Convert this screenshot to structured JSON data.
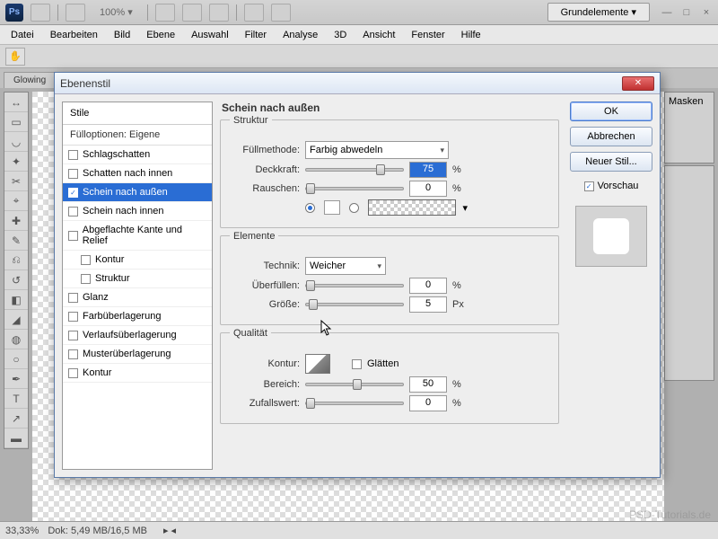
{
  "app": {
    "workspace": "Grundelemente ▾"
  },
  "menu": {
    "items": [
      "Datei",
      "Bearbeiten",
      "Bild",
      "Ebene",
      "Auswahl",
      "Filter",
      "Analyse",
      "3D",
      "Ansicht",
      "Fenster",
      "Hilfe"
    ]
  },
  "zoom_pct": "100% ▾",
  "doc_tab": "Glowing",
  "right_tab": "Masken",
  "status": {
    "zoom": "33,33%",
    "doc": "Dok: 5,49 MB/16,5 MB"
  },
  "watermark": "PSD-Tutorials.de",
  "dialog": {
    "title": "Ebenenstil",
    "styles_head": "Stile",
    "styles_sub": "Fülloptionen: Eigene",
    "items": [
      {
        "label": "Schlagschatten",
        "checked": false,
        "sel": false,
        "indent": false
      },
      {
        "label": "Schatten nach innen",
        "checked": false,
        "sel": false,
        "indent": false
      },
      {
        "label": "Schein nach außen",
        "checked": true,
        "sel": true,
        "indent": false
      },
      {
        "label": "Schein nach innen",
        "checked": false,
        "sel": false,
        "indent": false
      },
      {
        "label": "Abgeflachte Kante und Relief",
        "checked": false,
        "sel": false,
        "indent": false
      },
      {
        "label": "Kontur",
        "checked": false,
        "sel": false,
        "indent": true
      },
      {
        "label": "Struktur",
        "checked": false,
        "sel": false,
        "indent": true
      },
      {
        "label": "Glanz",
        "checked": false,
        "sel": false,
        "indent": false
      },
      {
        "label": "Farbüberlagerung",
        "checked": false,
        "sel": false,
        "indent": false
      },
      {
        "label": "Verlaufsüberlagerung",
        "checked": false,
        "sel": false,
        "indent": false
      },
      {
        "label": "Musterüberlagerung",
        "checked": false,
        "sel": false,
        "indent": false
      },
      {
        "label": "Kontur",
        "checked": false,
        "sel": false,
        "indent": false
      }
    ],
    "panel_title": "Schein nach außen",
    "g_struktur": "Struktur",
    "fullmethode_lbl": "Füllmethode:",
    "fullmethode_val": "Farbig abwedeln",
    "deckkraft_lbl": "Deckkraft:",
    "deckkraft_val": "75",
    "rauschen_lbl": "Rauschen:",
    "rauschen_val": "0",
    "pct": "%",
    "g_elemente": "Elemente",
    "technik_lbl": "Technik:",
    "technik_val": "Weicher",
    "uberfullen_lbl": "Überfüllen:",
    "uberfullen_val": "0",
    "grosse_lbl": "Größe:",
    "grosse_val": "5",
    "px": "Px",
    "g_qualitat": "Qualität",
    "kontur_lbl": "Kontur:",
    "glatten_lbl": "Glätten",
    "bereich_lbl": "Bereich:",
    "bereich_val": "50",
    "zufall_lbl": "Zufallswert:",
    "zufall_val": "0",
    "btn_ok": "OK",
    "btn_cancel": "Abbrechen",
    "btn_new": "Neuer Stil...",
    "vorschau_lbl": "Vorschau"
  }
}
